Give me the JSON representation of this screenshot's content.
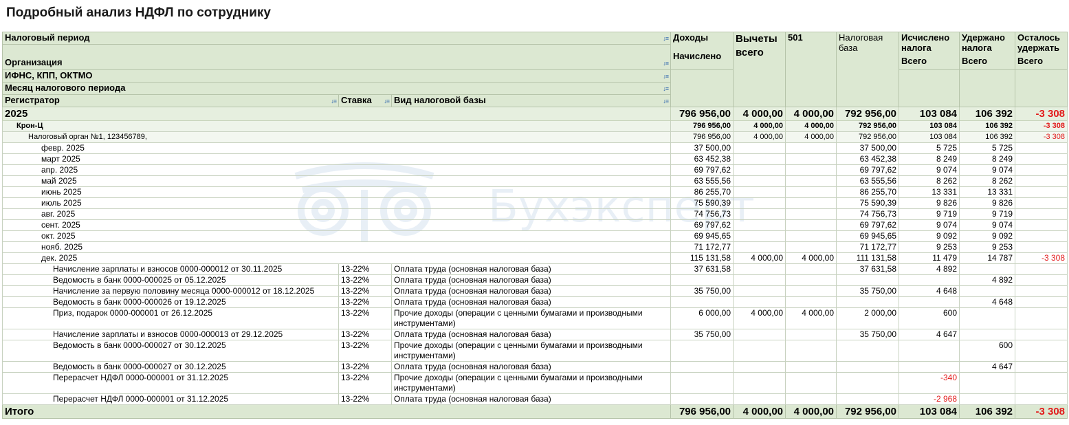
{
  "title": "Подробный анализ НДФЛ по сотруднику",
  "watermark_text": "Бухэксперт",
  "header": {
    "period": "Налоговый период",
    "org": "Организация",
    "ifns": "ИФНС, КПП, ОКТМО",
    "month": "Месяц налогового периода",
    "registrar": "Регистратор",
    "rate": "Ставка",
    "base_kind": "Вид налоговой базы",
    "income": "Доходы",
    "income_sub": "Начислено",
    "deductions": "Вычеты всего",
    "col501": "501",
    "tax_base": "Налоговая база",
    "calculated": "Исчислено налога",
    "calculated_sub": "Всего",
    "withheld": "Удержано налога",
    "withheld_sub": "Всего",
    "remaining": "Осталось удержать",
    "remaining_sub": "Всего"
  },
  "year_row": {
    "label": "2025",
    "income": "796 956,00",
    "ded": "4 000,00",
    "c501": "4 000,00",
    "base": "792 956,00",
    "calc": "103 084",
    "withheld": "106 392",
    "remain": "-3 308"
  },
  "org_row": {
    "label": "Крон-Ц",
    "income": "796 956,00",
    "ded": "4 000,00",
    "c501": "4 000,00",
    "base": "792 956,00",
    "calc": "103 084",
    "withheld": "106 392",
    "remain": "-3 308"
  },
  "ifns_row": {
    "label": "Налоговый орган №1, 123456789,",
    "income": "796 956,00",
    "ded": "4 000,00",
    "c501": "4 000,00",
    "base": "792 956,00",
    "calc": "103 084",
    "withheld": "106 392",
    "remain": "-3 308"
  },
  "months": [
    {
      "label": "февр. 2025",
      "income": "37 500,00",
      "base": "37 500,00",
      "calc": "5 725",
      "withheld": "5 725"
    },
    {
      "label": "март 2025",
      "income": "63 452,38",
      "base": "63 452,38",
      "calc": "8 249",
      "withheld": "8 249"
    },
    {
      "label": "апр. 2025",
      "income": "69 797,62",
      "base": "69 797,62",
      "calc": "9 074",
      "withheld": "9 074"
    },
    {
      "label": "май 2025",
      "income": "63 555,56",
      "base": "63 555,56",
      "calc": "8 262",
      "withheld": "8 262"
    },
    {
      "label": "июнь 2025",
      "income": "86 255,70",
      "base": "86 255,70",
      "calc": "13 331",
      "withheld": "13 331"
    },
    {
      "label": "июль 2025",
      "income": "75 590,39",
      "base": "75 590,39",
      "calc": "9 826",
      "withheld": "9 826"
    },
    {
      "label": "авг. 2025",
      "income": "74 756,73",
      "base": "74 756,73",
      "calc": "9 719",
      "withheld": "9 719"
    },
    {
      "label": "сент. 2025",
      "income": "69 797,62",
      "base": "69 797,62",
      "calc": "9 074",
      "withheld": "9 074"
    },
    {
      "label": "окт. 2025",
      "income": "69 945,65",
      "base": "69 945,65",
      "calc": "9 092",
      "withheld": "9 092"
    },
    {
      "label": "нояб. 2025",
      "income": "71 172,77",
      "base": "71 172,77",
      "calc": "9 253",
      "withheld": "9 253"
    }
  ],
  "dec_row": {
    "label": "дек. 2025",
    "income": "115 131,58",
    "ded": "4 000,00",
    "c501": "4 000,00",
    "base": "111 131,58",
    "calc": "11 479",
    "withheld": "14 787",
    "remain": "-3 308"
  },
  "docs": [
    {
      "label": "Начисление зарплаты и взносов 0000-000012 от 30.11.2025",
      "rate": "13-22%",
      "kind": "Оплата труда (основная налоговая база)",
      "income": "37 631,58",
      "base": "37 631,58",
      "calc": "4 892"
    },
    {
      "label": "Ведомость в банк 0000-000025 от 05.12.2025",
      "rate": "13-22%",
      "kind": "Оплата труда (основная налоговая база)",
      "withheld": "4 892"
    },
    {
      "label": "Начисление за первую половину месяца 0000-000012 от 18.12.2025",
      "rate": "13-22%",
      "kind": "Оплата труда (основная налоговая база)",
      "income": "35 750,00",
      "base": "35 750,00",
      "calc": "4 648"
    },
    {
      "label": "Ведомость в банк 0000-000026 от 19.12.2025",
      "rate": "13-22%",
      "kind": "Оплата труда (основная налоговая база)",
      "withheld": "4 648"
    },
    {
      "label": "Приз, подарок 0000-000001 от 26.12.2025",
      "rate": "13-22%",
      "kind": "Прочие доходы (операции с ценными бумагами и производными инструментами)",
      "income": "6 000,00",
      "ded": "4 000,00",
      "c501": "4 000,00",
      "base": "2 000,00",
      "calc": "600",
      "tall": true
    },
    {
      "label": "Начисление зарплаты и взносов 0000-000013 от 29.12.2025",
      "rate": "13-22%",
      "kind": "Оплата труда (основная налоговая база)",
      "income": "35 750,00",
      "base": "35 750,00",
      "calc": "4 647"
    },
    {
      "label": "Ведомость в банк 0000-000027 от 30.12.2025",
      "rate": "13-22%",
      "kind": "Прочие доходы (операции с ценными бумагами и производными инструментами)",
      "withheld": "600",
      "tall": true
    },
    {
      "label": "Ведомость в банк 0000-000027 от 30.12.2025",
      "rate": "13-22%",
      "kind": "Оплата труда (основная налоговая база)",
      "withheld": "4 647"
    },
    {
      "label": "Перерасчет НДФЛ 0000-000001 от 31.12.2025",
      "rate": "13-22%",
      "kind": "Прочие доходы (операции с ценными бумагами и производными инструментами)",
      "calc": "-340",
      "calc_neg": true,
      "tall": true
    },
    {
      "label": "Перерасчет НДФЛ 0000-000001 от 31.12.2025",
      "rate": "13-22%",
      "kind": "Оплата труда (основная налоговая база)",
      "calc": "-2 968",
      "calc_neg": true
    }
  ],
  "total_row": {
    "label": "Итого",
    "income": "796 956,00",
    "ded": "4 000,00",
    "c501": "4 000,00",
    "base": "792 956,00",
    "calc": "103 084",
    "withheld": "106 392",
    "remain": "-3 308"
  }
}
